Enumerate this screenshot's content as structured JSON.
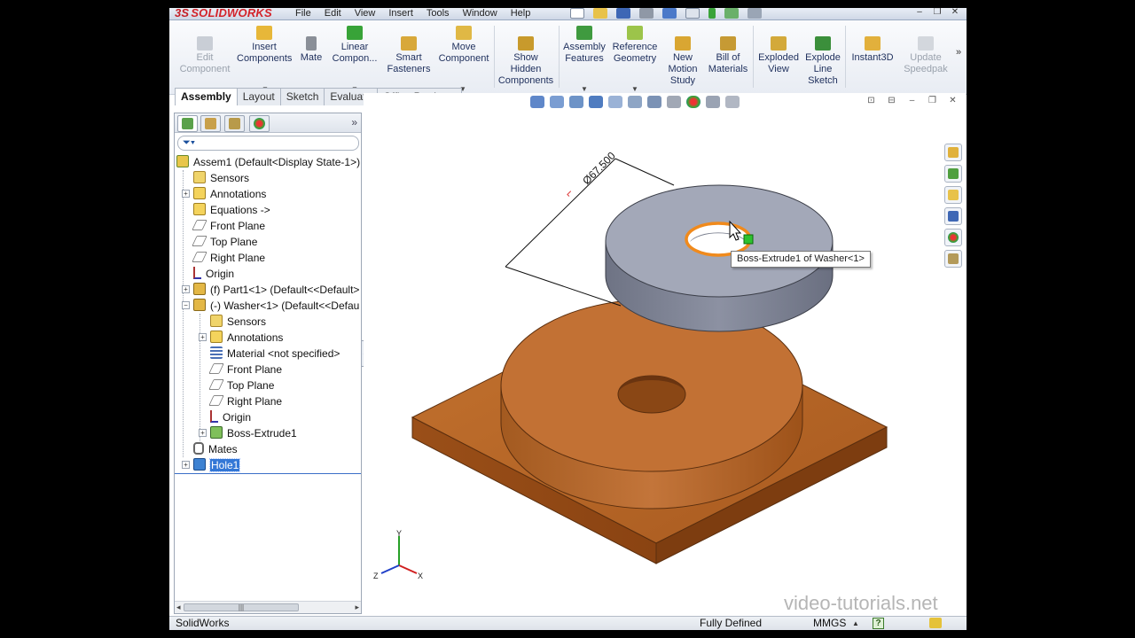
{
  "menubar": {
    "logo_ds": "3S",
    "logo_text": "SOLIDWORKS",
    "items": [
      "File",
      "Edit",
      "View",
      "Insert",
      "Tools",
      "Window",
      "Help"
    ]
  },
  "ribbon": {
    "edit_component": "Edit\nComponent",
    "insert_components": "Insert\nComponents",
    "mate": "Mate",
    "linear_component": "Linear\nCompon...",
    "smart_fasteners": "Smart\nFasteners",
    "move_component": "Move\nComponent",
    "show_hidden": "Show\nHidden\nComponents",
    "assembly_features": "Assembly\nFeatures",
    "reference_geometry": "Reference\nGeometry",
    "new_motion_study": "New\nMotion\nStudy",
    "bill_of_materials": "Bill of\nMaterials",
    "exploded_view": "Exploded\nView",
    "explode_line_sketch": "Explode\nLine\nSketch",
    "instant3d": "Instant3D",
    "update_speedpak": "Update\nSpeedpak"
  },
  "tabs": [
    "Assembly",
    "Layout",
    "Sketch",
    "Evaluate",
    "Office Products"
  ],
  "tree": {
    "root": "Assem1  (Default<Display State-1>)",
    "sensors": "Sensors",
    "annotations": "Annotations",
    "equations": "Equations ->",
    "front_plane": "Front Plane",
    "top_plane": "Top Plane",
    "right_plane": "Right Plane",
    "origin": "Origin",
    "part1": "(f) Part1<1> (Default<<Default>",
    "washer": "(-) Washer<1> (Default<<Defau",
    "w_sensors": "Sensors",
    "w_annotations": "Annotations",
    "w_material": "Material <not specified>",
    "w_front_plane": "Front Plane",
    "w_top_plane": "Top Plane",
    "w_right_plane": "Right Plane",
    "w_origin": "Origin",
    "w_boss_extrude": "Boss-Extrude1",
    "mates": "Mates",
    "hole1": "Hole1"
  },
  "graphics": {
    "dimension": "Ø67.500",
    "tooltip": "Boss-Extrude1 of Washer<1>",
    "watermark": "video-tutorials.net",
    "axis_x": "X",
    "axis_y": "Y",
    "axis_z": "Z"
  },
  "statusbar": {
    "app": "SolidWorks",
    "status": "Fully Defined",
    "units": "MMGS",
    "help": "?"
  },
  "colors": {
    "brand_red": "#d3232a",
    "part_brown": "#b5652a",
    "washer_gray": "#9ea3b2",
    "selection_orange": "#f08a1c",
    "tree_selection": "#3377d6"
  }
}
